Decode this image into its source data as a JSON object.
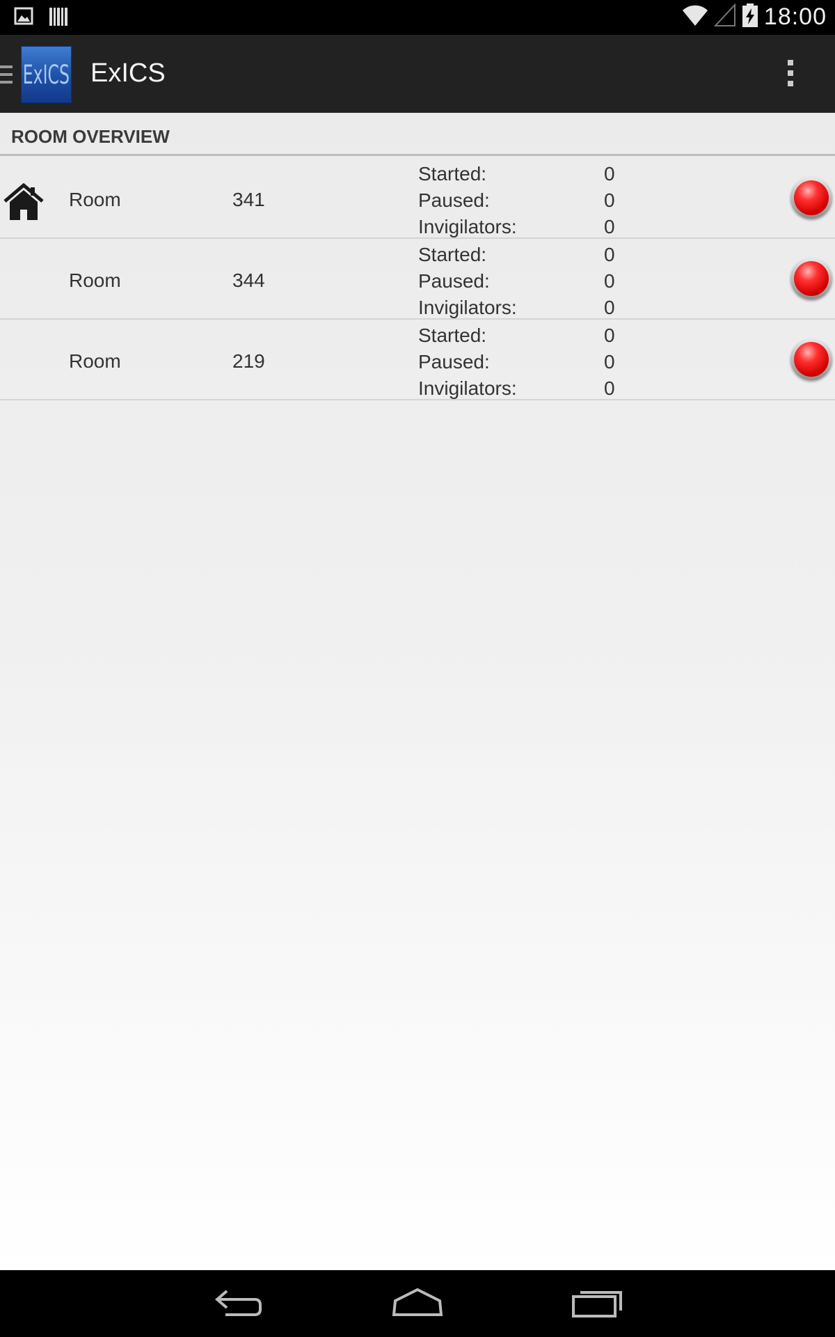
{
  "status_bar": {
    "time": "18:00",
    "notification_icons": [
      "image-icon",
      "barcode-icon"
    ],
    "system_icons": [
      "wifi-icon",
      "signal-icon",
      "battery-charging-icon"
    ]
  },
  "action_bar": {
    "logo_text": "ExICS",
    "title": "ExICS",
    "drawer_icon": "drawer-toggle-icon",
    "menu_icon": "overflow-menu-icon"
  },
  "section": {
    "title": "ROOM OVERVIEW"
  },
  "rooms": [
    {
      "label": "Room",
      "number": "341",
      "home": true,
      "started_label": "Started:",
      "started": "0",
      "paused_label": "Paused:",
      "paused": "0",
      "invigilators_label": "Invigilators:",
      "invigilators": "0",
      "status_color": "#e01010"
    },
    {
      "label": "Room",
      "number": "344",
      "home": false,
      "started_label": "Started:",
      "started": "0",
      "paused_label": "Paused:",
      "paused": "0",
      "invigilators_label": "Invigilators:",
      "invigilators": "0",
      "status_color": "#e01010"
    },
    {
      "label": "Room",
      "number": "219",
      "home": false,
      "started_label": "Started:",
      "started": "0",
      "paused_label": "Paused:",
      "paused": "0",
      "invigilators_label": "Invigilators:",
      "invigilators": "0",
      "status_color": "#e01010"
    }
  ],
  "nav_bar": {
    "buttons": [
      "back-icon",
      "home-nav-icon",
      "recent-apps-icon"
    ]
  }
}
